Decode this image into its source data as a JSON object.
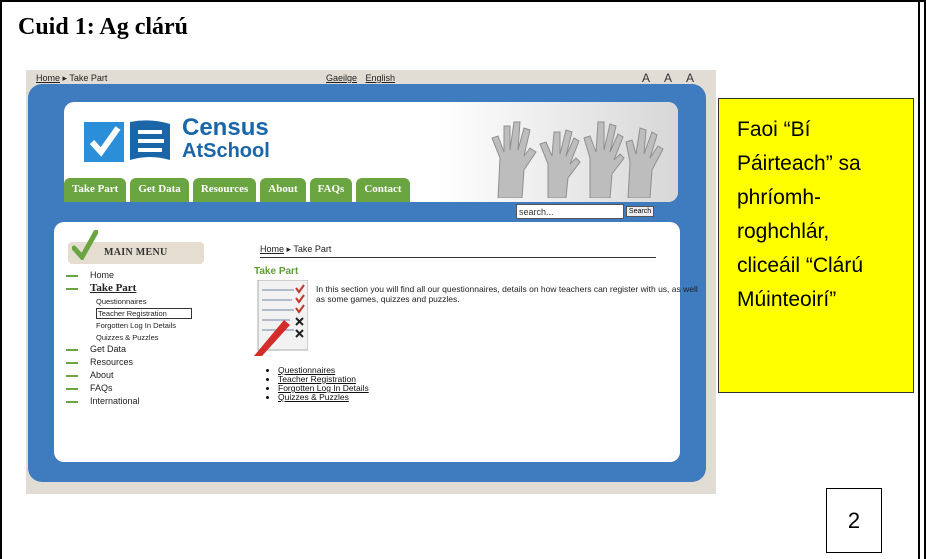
{
  "doc": {
    "heading": "Cuid 1: Ag clárú",
    "page_number": "2",
    "note": "Faoi “Bí Páirteach” sa phríomh-roghchlár, cliceáil “Clárú Múinteoirí”"
  },
  "site": {
    "topbar": {
      "home": "Home",
      "separator": "▸",
      "current": "Take Part",
      "lang_ga": "Gaeilge",
      "lang_en": "English",
      "font_icons": "A A A"
    },
    "logo": {
      "line1": "Census",
      "line2": "AtSchool"
    },
    "nav": [
      "Take Part",
      "Get Data",
      "Resources",
      "About",
      "FAQs",
      "Contact"
    ],
    "search": {
      "placeholder": "search...",
      "button": "Search"
    },
    "menu_title": "MAIN MENU",
    "menu": {
      "home": "Home",
      "take_part": "Take Part",
      "sub": [
        "Questionnaires",
        "Teacher Registration",
        "Forgotten Log In Details",
        "Quizzes & Puzzles"
      ],
      "after": [
        "Get Data",
        "Resources",
        "About",
        "FAQs",
        "International"
      ]
    },
    "breadcrumb": {
      "home": "Home",
      "separator": "▸",
      "current": "Take Part"
    },
    "section_title": "Take Part",
    "intro": "In this section you will find all our questionnaires, details on how teachers can register with us, as well as some games, quizzes and puzzles.",
    "links": [
      "Questionnaires",
      "Teacher Registration",
      "Forgotten Log In Details",
      "Quizzes & Puzzles"
    ]
  },
  "colors": {
    "accent_green": "#6aa542",
    "frame_blue": "#3f7bbf",
    "note_yellow": "#ffff00"
  }
}
